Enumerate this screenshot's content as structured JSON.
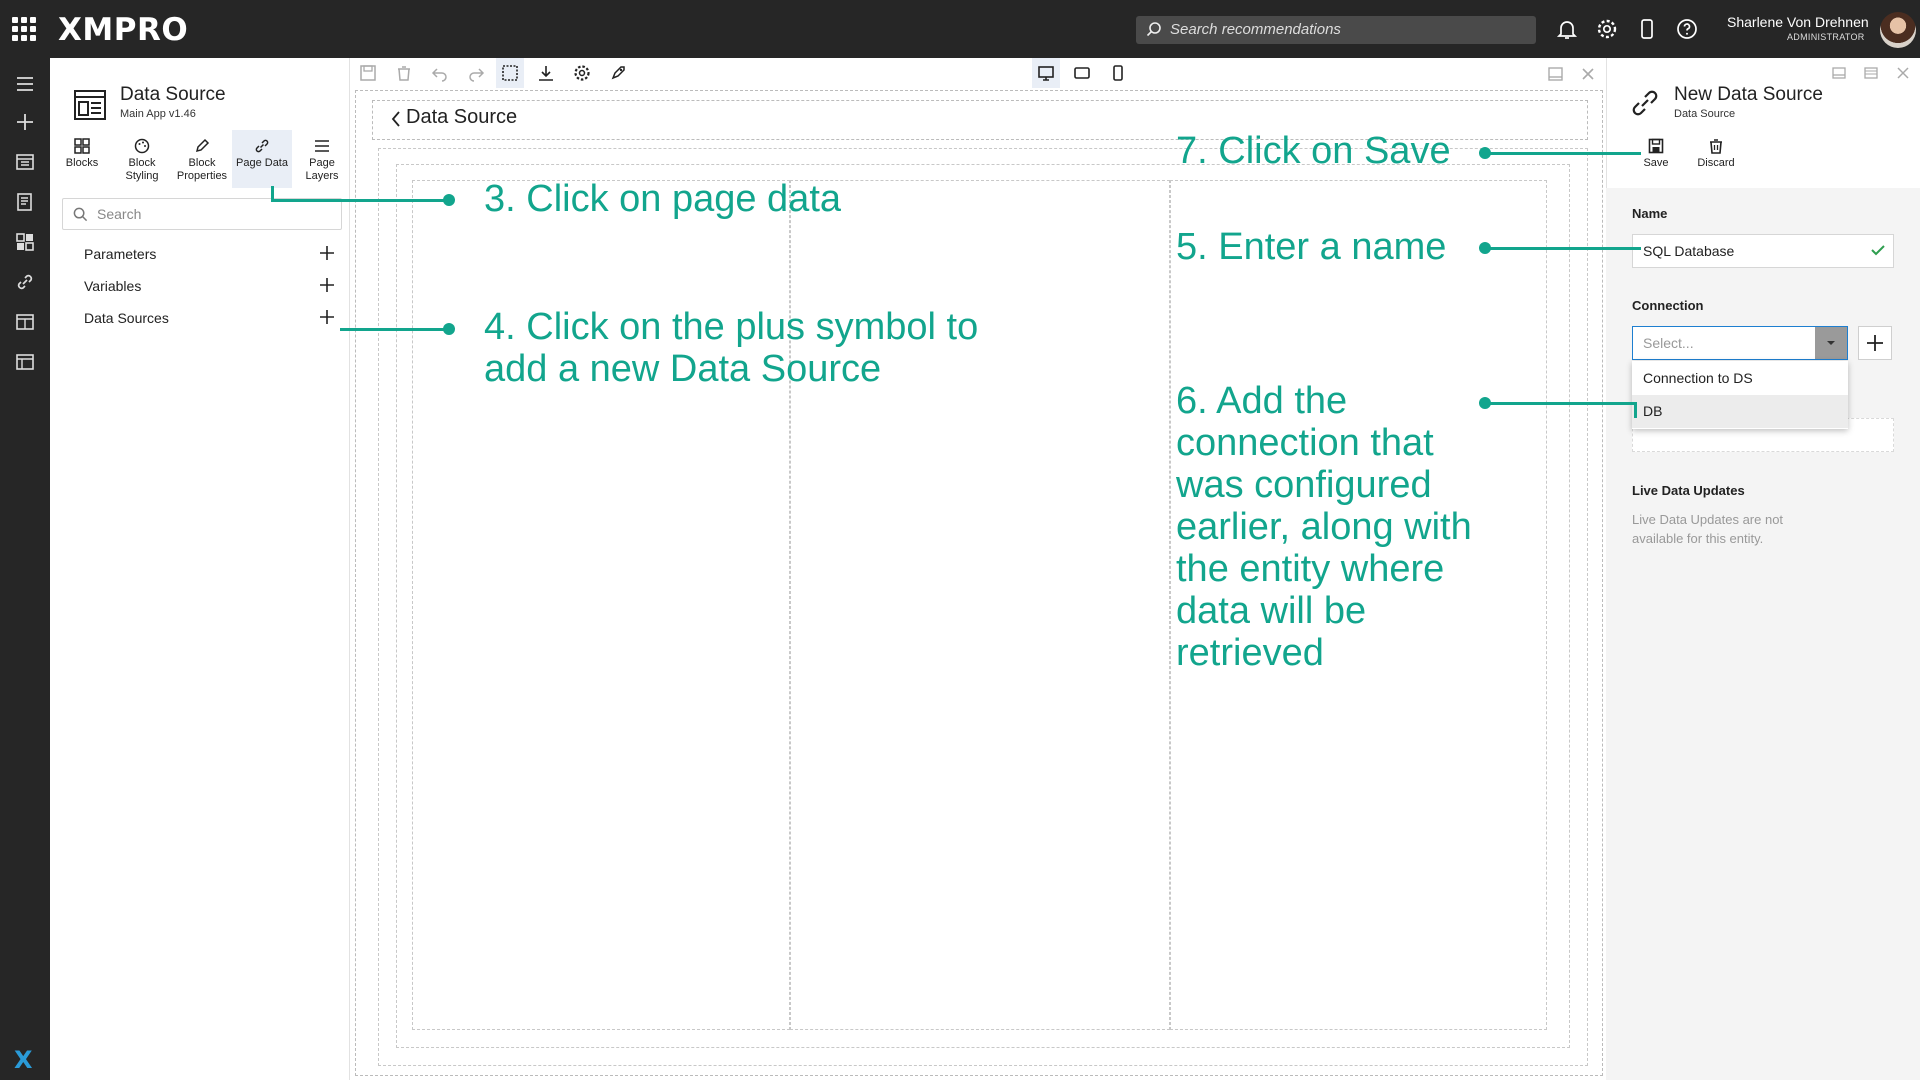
{
  "topbar": {
    "logo": "XMPRO",
    "search_placeholder": "Search recommendations",
    "user_name": "Sharlene Von Drehnen",
    "user_role": "ADMINISTRATOR"
  },
  "sidebar": {
    "title": "Data Source",
    "subtitle": "Main App v1.46",
    "tools": [
      {
        "label": "Blocks",
        "icon": "blocks-icon"
      },
      {
        "label": "Block Styling",
        "icon": "palette-icon"
      },
      {
        "label": "Block Properties",
        "icon": "pencil-icon"
      },
      {
        "label": "Page Data",
        "icon": "link-icon"
      },
      {
        "label": "Page Layers",
        "icon": "layers-icon"
      }
    ],
    "search_placeholder": "Search",
    "items": [
      {
        "label": "Parameters"
      },
      {
        "label": "Variables"
      },
      {
        "label": "Data Sources"
      }
    ]
  },
  "canvas": {
    "back_title": "Data Source"
  },
  "right_panel": {
    "title": "New Data Source",
    "subtitle": "Data Source",
    "save_label": "Save",
    "discard_label": "Discard",
    "name_label": "Name",
    "name_value": "SQL Database",
    "connection_label": "Connection",
    "connection_placeholder": "Select...",
    "connection_options": [
      "Connection to DS",
      "DB"
    ],
    "live_label": "Live Data Updates",
    "live_text": "Live Data Updates are not available for this entity."
  },
  "annotations": {
    "step3": "3. Click on page data",
    "step4_line1": "4. Click on the plus symbol to",
    "step4_line2": "add a new Data Source",
    "step5": "5. Enter a name",
    "step6": [
      "6. Add the",
      "connection that",
      "was configured",
      "earlier, along with",
      "the entity where",
      "data will be",
      "retrieved"
    ],
    "step7": "7. Click on Save"
  },
  "colors": {
    "accent": "#12a58d",
    "topbar": "#262626",
    "select_border": "#1e7fd0"
  }
}
